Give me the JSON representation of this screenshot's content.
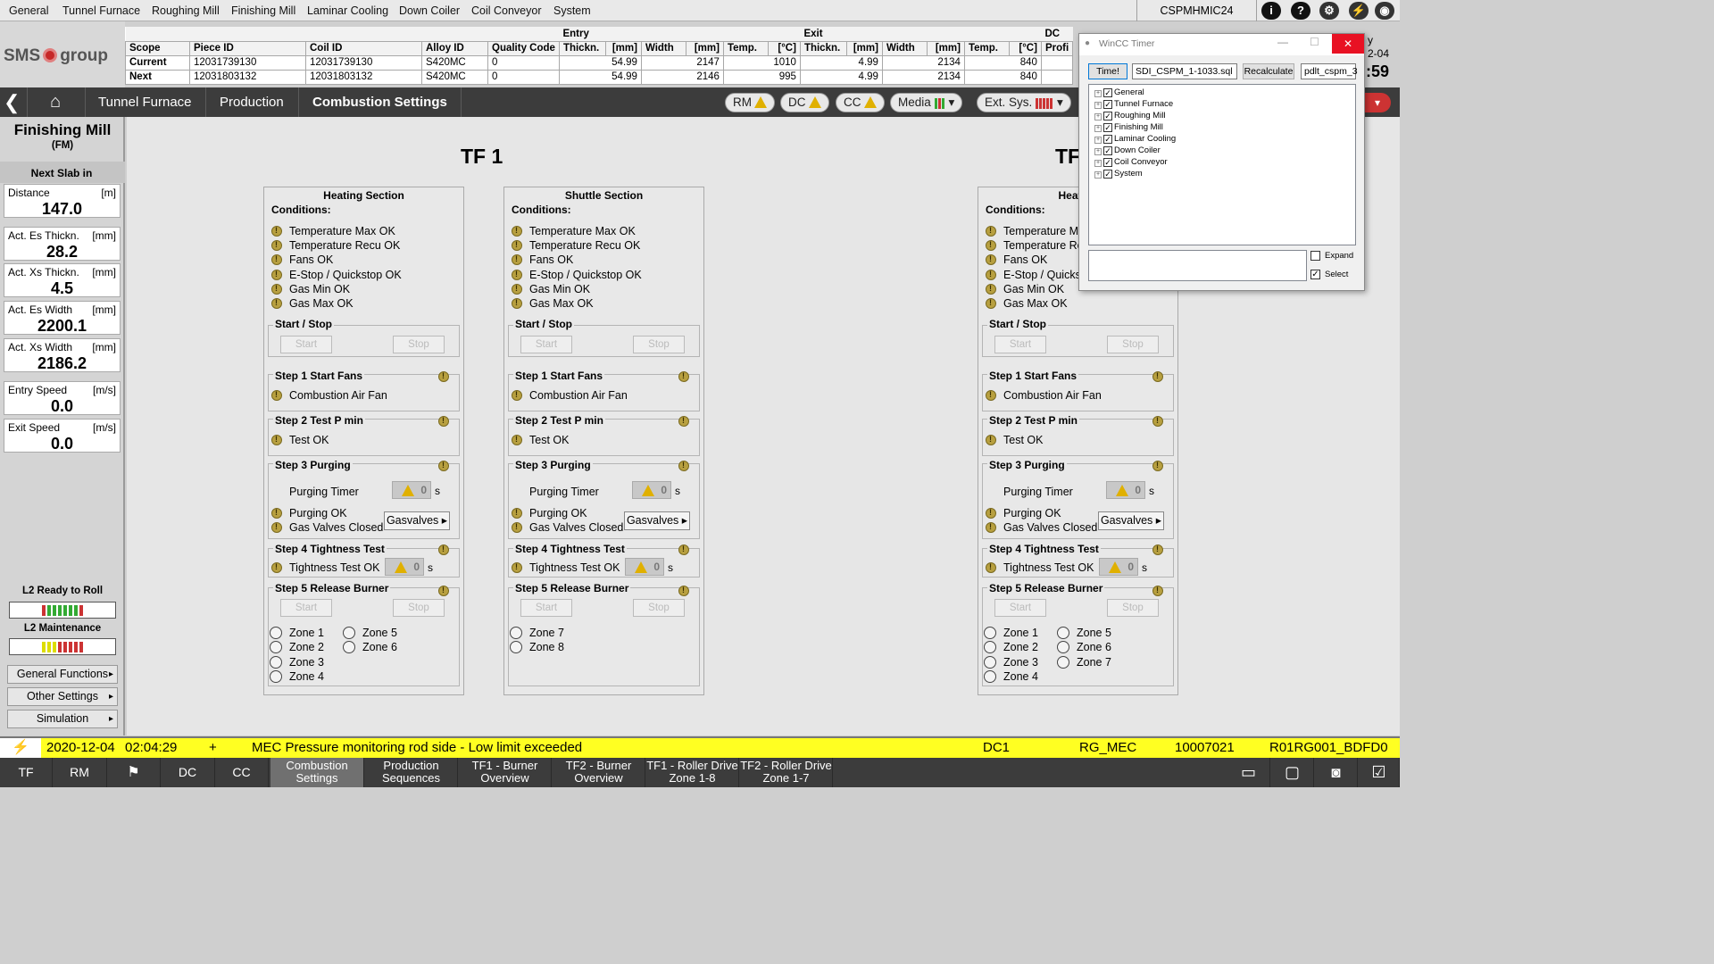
{
  "menu": [
    "General",
    "Tunnel Furnace",
    "Roughing Mill",
    "Finishing Mill",
    "Laminar Cooling",
    "Down Coiler",
    "Coil Conveyor",
    "System"
  ],
  "host": "CSPMHMIC24",
  "logo": {
    "left": "SMS",
    "right": "group"
  },
  "slab_table": {
    "group_entry": "Entry",
    "group_exit": "Exit",
    "group_extra": "DC",
    "headers": [
      "Scope",
      "Piece ID",
      "Coil ID",
      "Alloy ID",
      "Quality Code",
      "Thickn.",
      "[mm]",
      "Width",
      "[mm]",
      "Temp.",
      "[°C]",
      "Thickn.",
      "[mm]",
      "Width",
      "[mm]",
      "Temp.",
      "[°C]",
      "Profi"
    ],
    "rows": [
      [
        "Current",
        "12031739130",
        "12031739130",
        "S420MC",
        "0",
        "54.99",
        "",
        "2147",
        "",
        "1010",
        "",
        "4.99",
        "",
        "2134",
        "",
        "840",
        ""
      ],
      [
        "Next",
        "12031803132",
        "12031803132",
        "S420MC",
        "0",
        "54.99",
        "",
        "2146",
        "",
        "995",
        "",
        "4.99",
        "",
        "2134",
        "",
        "840",
        ""
      ]
    ]
  },
  "time_fragments": {
    "date": "2-04",
    "time": ":59",
    "y": "y"
  },
  "breadcrumb": [
    "Tunnel Furnace",
    "Production",
    "Combustion Settings"
  ],
  "status_pills": [
    "RM",
    "DC",
    "CC",
    "Media",
    "Ext. Sys."
  ],
  "left_panel": {
    "title": "Finishing Mill",
    "subtitle": "(FM)",
    "next_slab": "Next Slab in",
    "boxes": [
      {
        "label": "Distance",
        "unit": "[m]",
        "value": "147.0"
      },
      {
        "label": "Act. Es Thickn.",
        "unit": "[mm]",
        "value": "28.2"
      },
      {
        "label": "Act. Xs Thickn.",
        "unit": "[mm]",
        "value": "4.5"
      },
      {
        "label": "Act. Es Width",
        "unit": "[mm]",
        "value": "2200.1"
      },
      {
        "label": "Act. Xs Width",
        "unit": "[mm]",
        "value": "2186.2"
      },
      {
        "label": "Entry Speed",
        "unit": "[m/s]",
        "value": "0.0"
      },
      {
        "label": "Exit Speed",
        "unit": "[m/s]",
        "value": "0.0"
      }
    ],
    "l2_ready": "L2 Ready to Roll",
    "l2_maint": "L2 Maintenance",
    "buttons": [
      "General Functions",
      "Other Settings",
      "Simulation"
    ]
  },
  "tf1_title": "TF 1",
  "tf2_title": "TF",
  "panel_common": {
    "conditions": "Conditions:",
    "condition_items": [
      "Temperature Max OK",
      "Temperature Recu OK",
      "Fans OK",
      "E-Stop / Quickstop OK",
      "Gas Min OK",
      "Gas Max OK"
    ],
    "start_stop": "Start / Stop",
    "start": "Start",
    "stop": "Stop",
    "step1": "Step 1 Start Fans",
    "step1_item": "Combustion Air Fan",
    "step2": "Step 2 Test P min",
    "step2_item": "Test OK",
    "step3": "Step 3 Purging",
    "purging_timer": "Purging Timer",
    "purging_value": "0",
    "unit_s": "s",
    "purging_ok": "Purging OK",
    "gas_closed": "Gas Valves Closed",
    "gasvalves": "Gasvalves",
    "step4": "Step 4 Tightness Test",
    "tightness_ok": "Tightness Test OK",
    "tightness_value": "0",
    "step5": "Step 5 Release Burner"
  },
  "panels": [
    {
      "title": "Heating Section",
      "zones": [
        "Zone 1",
        "Zone 2",
        "Zone 3",
        "Zone 4",
        "Zone 5",
        "Zone 6"
      ]
    },
    {
      "title": "Shuttle Section",
      "zones": [
        "Zone 7",
        "Zone 8"
      ]
    },
    {
      "title": "Heating",
      "zones": [
        "Zone 1",
        "Zone 2",
        "Zone 3",
        "Zone 4",
        "Zone 5",
        "Zone 6",
        "Zone 7"
      ]
    }
  ],
  "panel3_conditions": [
    "Temperature Ma",
    "Temperature Re",
    "Fans OK",
    "E-Stop / Quickst",
    "Gas Min OK",
    "Gas Max OK"
  ],
  "alarm": {
    "date": "2020-12-04",
    "time": "02:04:29",
    "plus": "+",
    "message": "MEC Pressure monitoring rod side - Low limit exceeded",
    "area": "DC1",
    "group": "RG_MEC",
    "id": "10007021",
    "tag": "R01RG001_BDFD0"
  },
  "taskbar": [
    "TF",
    "RM",
    "DC",
    "CC",
    "Combustion Settings",
    "Production Sequences",
    "TF1 - Burner Overview",
    "TF2 - Burner Overview",
    "TF1 - Roller Drive Zone 1-8",
    "TF2 - Roller Drive Zone 1-7"
  ],
  "dialog": {
    "title": "WinCC Timer",
    "time_btn": "Time!",
    "file": "SDI_CSPM_1-1033.sql",
    "recalc": "Recalculate",
    "server": "pdlt_cspm_3",
    "tree": [
      "General",
      "Tunnel Furnace",
      "Roughing Mill",
      "Finishing Mill",
      "Laminar Cooling",
      "Down Coiler",
      "Coil Conveyor",
      "System"
    ],
    "expand": "Expand",
    "select": "Select"
  },
  "colors": {
    "alarm_bg": "#ffff22",
    "nav_bg": "#3c3c3c",
    "warning": "#e0b000"
  }
}
